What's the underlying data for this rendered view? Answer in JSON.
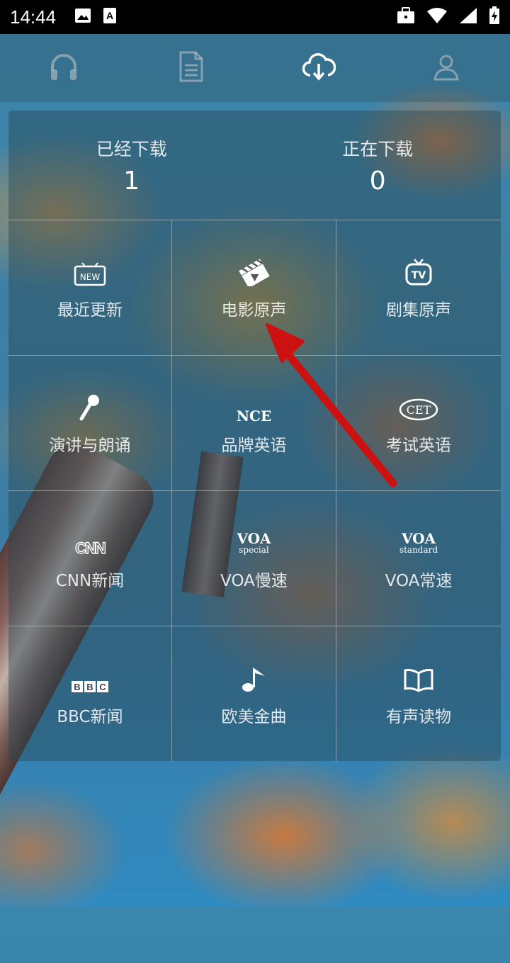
{
  "status_bar": {
    "time": "14:44",
    "icons_left": [
      "image-icon",
      "text-a-icon"
    ],
    "icons_right": [
      "briefcase-icon",
      "wifi-icon",
      "signal-icon",
      "battery-charging-icon"
    ]
  },
  "top_nav": {
    "items": [
      {
        "name": "listen",
        "icon": "headphones-icon",
        "active": false
      },
      {
        "name": "articles",
        "icon": "document-icon",
        "active": false
      },
      {
        "name": "download",
        "icon": "cloud-download-icon",
        "active": true
      },
      {
        "name": "profile",
        "icon": "user-icon",
        "active": false
      }
    ]
  },
  "stats": {
    "downloaded_label": "已经下载",
    "downloaded_count": "1",
    "downloading_label": "正在下载",
    "downloading_count": "0"
  },
  "categories": [
    {
      "label": "最近更新",
      "icon": "new-badge-icon",
      "icon_text": "NEW"
    },
    {
      "label": "电影原声",
      "icon": "clapperboard-icon"
    },
    {
      "label": "剧集原声",
      "icon": "tv-icon",
      "icon_text": "TV"
    },
    {
      "label": "演讲与朗诵",
      "icon": "microphone-icon"
    },
    {
      "label": "品牌英语",
      "icon": "nce-logo-icon",
      "icon_text": "NCE"
    },
    {
      "label": "考试英语",
      "icon": "cet-logo-icon",
      "icon_text": "CET"
    },
    {
      "label": "CNN新闻",
      "icon": "cnn-logo-icon",
      "icon_text": "CNN"
    },
    {
      "label": "VOA慢速",
      "icon": "voa-special-icon",
      "icon_text": "VOA",
      "icon_subtext": "special"
    },
    {
      "label": "VOA常速",
      "icon": "voa-standard-icon",
      "icon_text": "VOA",
      "icon_subtext": "standard"
    },
    {
      "label": "BBC新闻",
      "icon": "bbc-logo-icon",
      "icon_text": "BBC"
    },
    {
      "label": "欧美金曲",
      "icon": "music-note-icon"
    },
    {
      "label": "有声读物",
      "icon": "open-book-icon"
    }
  ],
  "annotation": {
    "arrow_color": "#cc1111",
    "points_to": "电影原声"
  }
}
